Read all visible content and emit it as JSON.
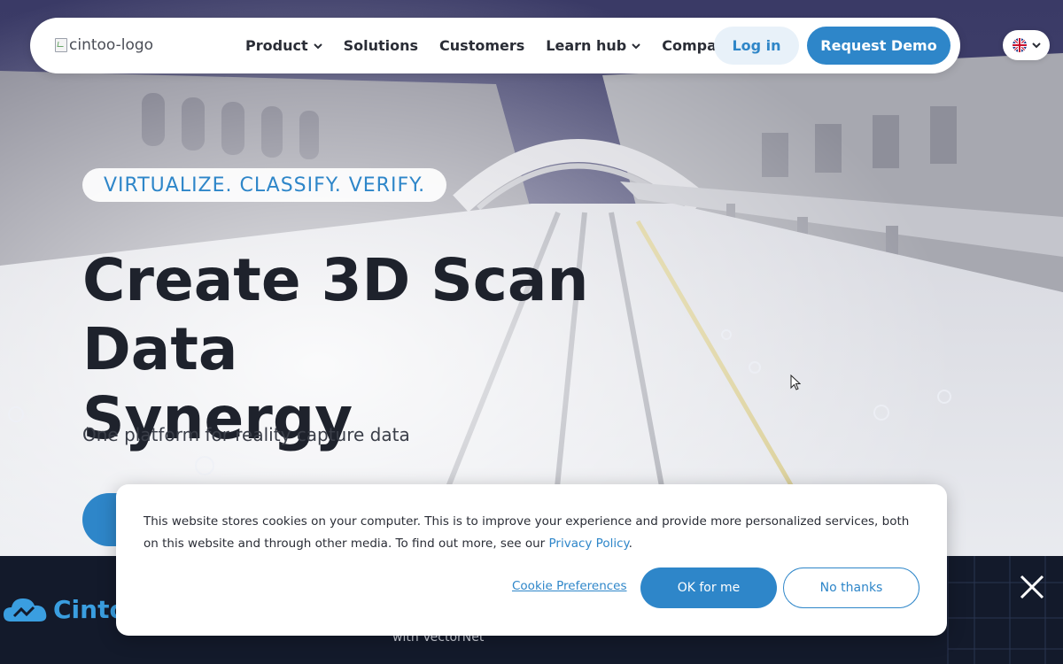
{
  "nav": {
    "logo_alt": "cintoo-logo",
    "items": [
      {
        "label": "Product",
        "has_dropdown": true
      },
      {
        "label": "Solutions",
        "has_dropdown": false
      },
      {
        "label": "Customers",
        "has_dropdown": false
      },
      {
        "label": "Learn hub",
        "has_dropdown": true
      },
      {
        "label": "Company",
        "has_dropdown": true
      }
    ],
    "login_label": "Log in",
    "demo_label": "Request Demo",
    "language_icon": "uk-flag-icon"
  },
  "hero": {
    "tagline": "VIRTUALIZE. CLASSIFY. VERIFY.",
    "headline_line1": "Create 3D Scan Data",
    "headline_line2": "Synergy",
    "subline": "One platform for reality capture data"
  },
  "banner": {
    "logo_text": "Cintoo",
    "subtext": "with VectorNet"
  },
  "cookie": {
    "text_before_link": "This website stores cookies on your computer. This is to improve your experience and provide more personalized services, both on this website and through other media. To find out more, see our ",
    "link_label": "Privacy Policy",
    "text_after_link": ".",
    "preferences_label": "Cookie Preferences",
    "accept_label": "OK for me",
    "decline_label": "No thanks"
  },
  "colors": {
    "accent": "#2e86c9",
    "dark_text": "#1e222c",
    "banner_bg": "#131a2b"
  }
}
